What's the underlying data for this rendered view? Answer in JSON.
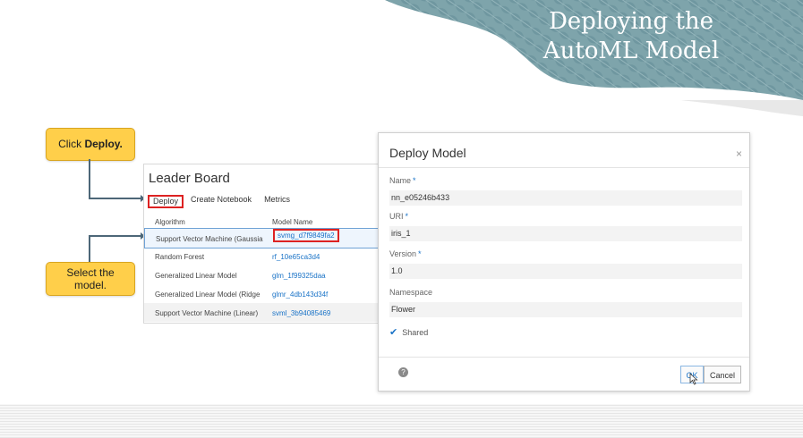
{
  "slide": {
    "title_line1": "Deploying the",
    "title_line2": "AutoML Model"
  },
  "callouts": {
    "deploy_prefix": "Click ",
    "deploy_bold": "Deploy.",
    "select_line1": "Select the",
    "select_line2": "model."
  },
  "leader_board": {
    "title": "Leader Board",
    "tabs": [
      "Deploy",
      "Create Notebook",
      "Metrics"
    ],
    "columns": [
      "Algorithm",
      "Model Name"
    ],
    "rows": [
      {
        "algorithm": "Support Vector Machine (Gaussian)",
        "model": "svmg_d7f9849fa2"
      },
      {
        "algorithm": "Random Forest",
        "model": "rf_10e65ca3d4"
      },
      {
        "algorithm": "Generalized Linear Model",
        "model": "glm_1f99325daa"
      },
      {
        "algorithm": "Generalized Linear Model (Ridge ...",
        "model": "glmr_4db143d34f"
      },
      {
        "algorithm": "Support Vector Machine (Linear)",
        "model": "svml_3b94085469"
      }
    ]
  },
  "dialog": {
    "title": "Deploy Model",
    "close": "×",
    "fields": [
      {
        "label": "Name",
        "required": "*",
        "value": "nn_e05246b433"
      },
      {
        "label": "URI",
        "required": "*",
        "value": "iris_1"
      },
      {
        "label": "Version",
        "required": "*",
        "value": "1.0"
      },
      {
        "label": "Namespace",
        "required": "",
        "value": "Flower"
      }
    ],
    "shared_label": "Shared",
    "help": "?",
    "ok_label": "OK",
    "cancel_label": "Cancel"
  },
  "colors": {
    "header_teal": "#7aa0a8",
    "callout_yellow": "#ffcf4a",
    "highlight_red": "#dd2222",
    "link_blue": "#1a73c7"
  }
}
